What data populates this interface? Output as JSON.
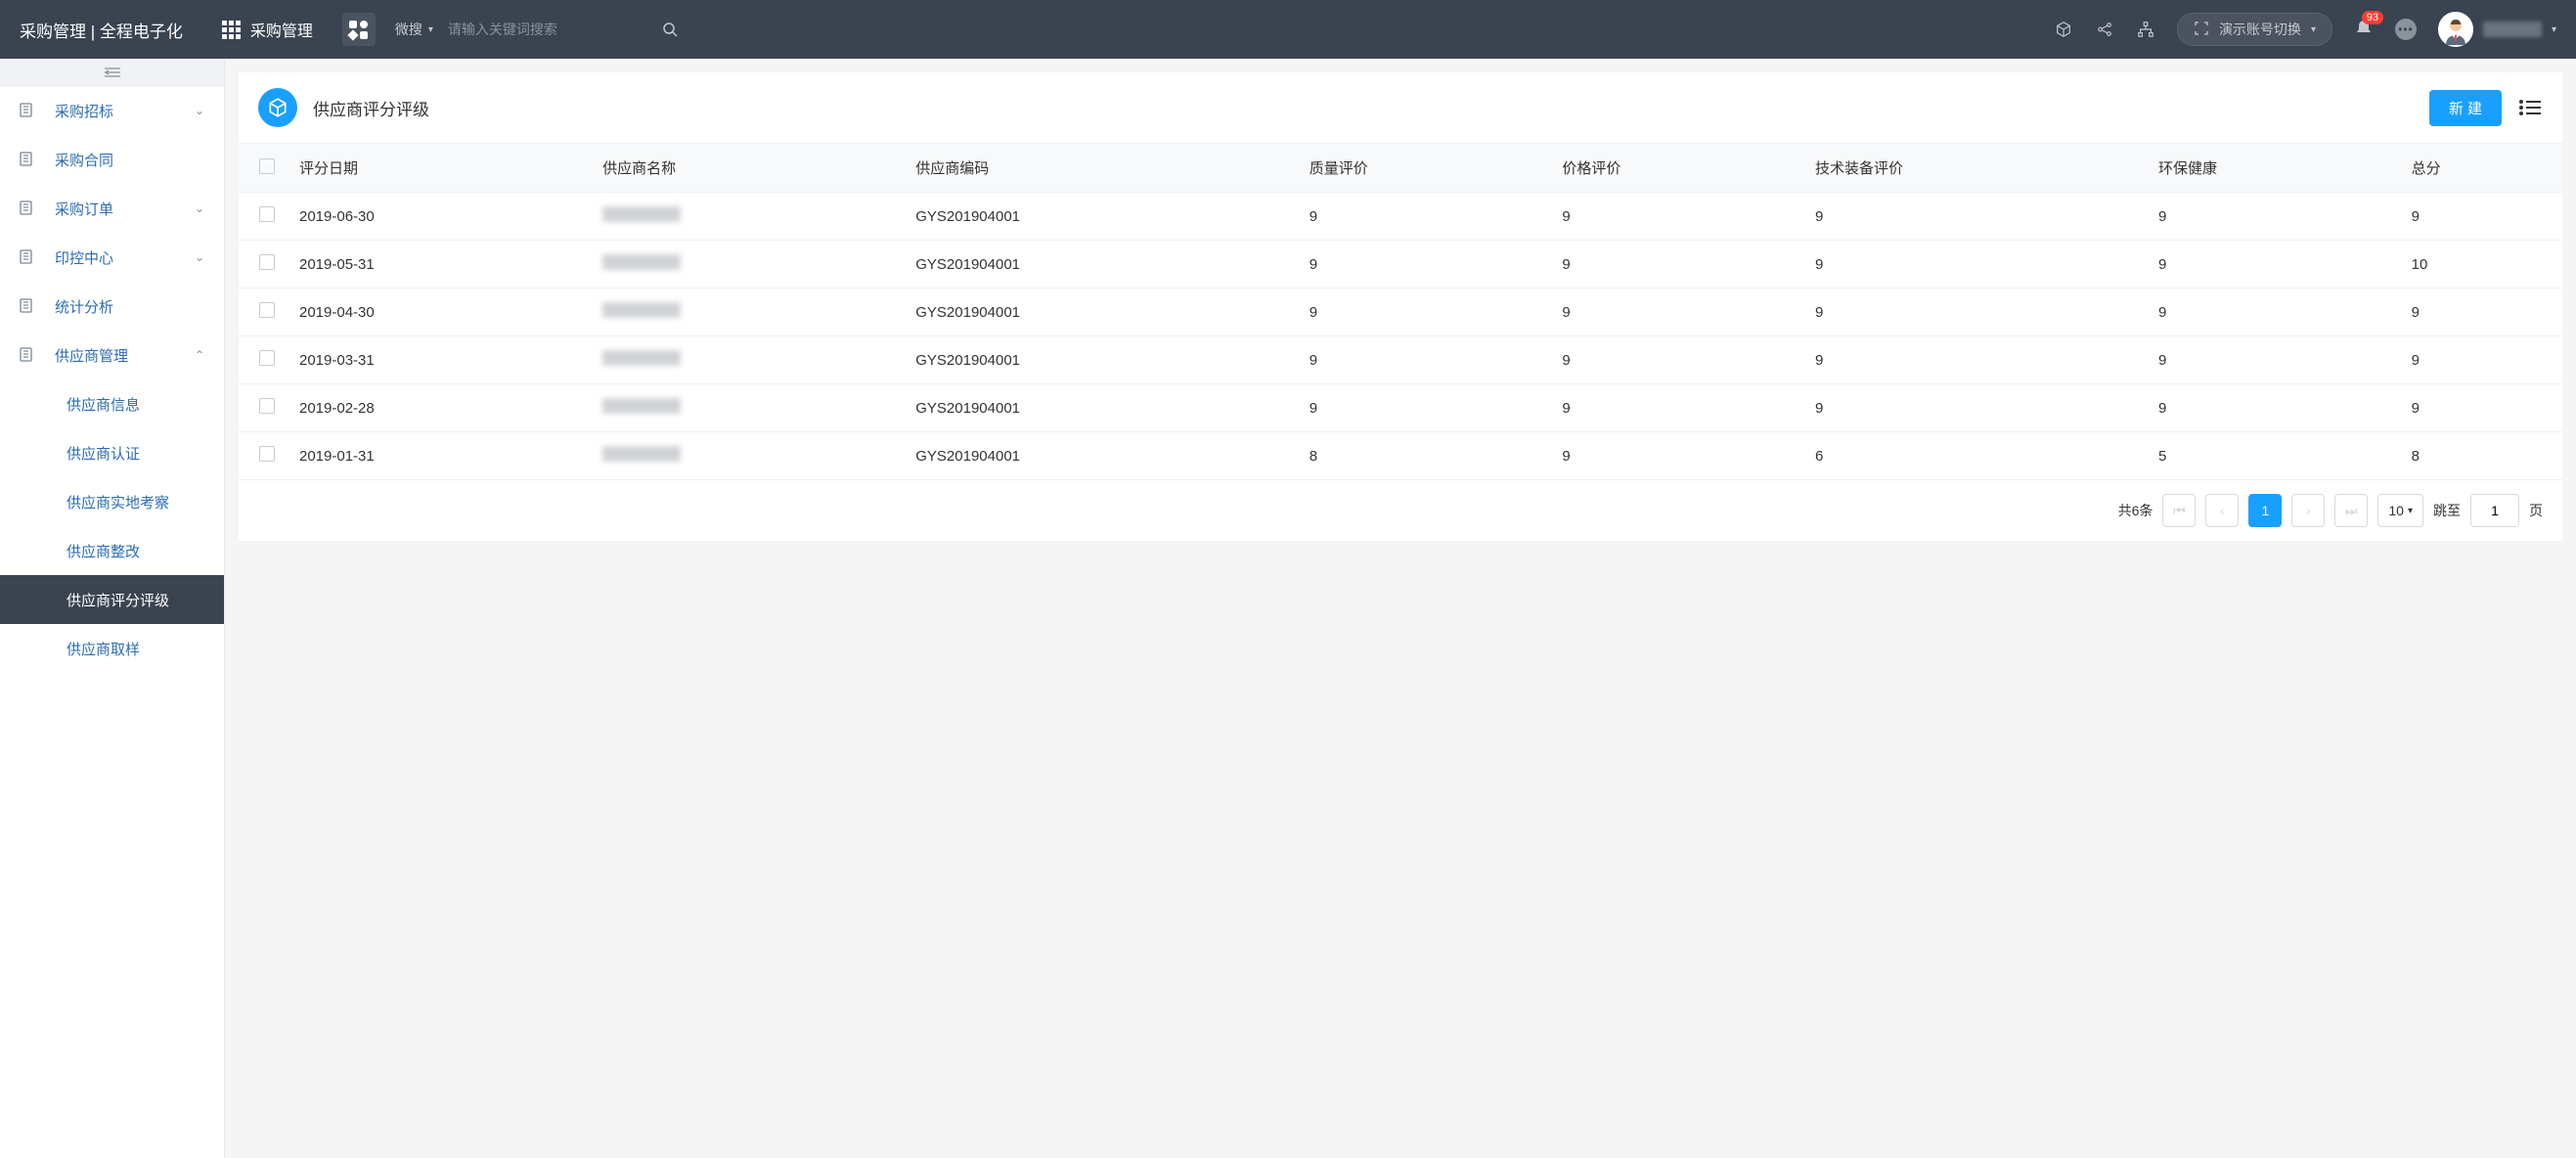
{
  "header": {
    "title": "采购管理 | 全程电子化",
    "apps_label": "采购管理",
    "search_type": "微搜",
    "search_placeholder": "请输入关键词搜索",
    "account_switch": "演示账号切换",
    "badge_count": "93"
  },
  "sidebar": {
    "items": [
      {
        "label": "采购招标",
        "expandable": true,
        "expanded": false
      },
      {
        "label": "采购合同",
        "expandable": false
      },
      {
        "label": "采购订单",
        "expandable": true,
        "expanded": false
      },
      {
        "label": "印控中心",
        "expandable": true,
        "expanded": false
      },
      {
        "label": "统计分析",
        "expandable": false
      },
      {
        "label": "供应商管理",
        "expandable": true,
        "expanded": true
      }
    ],
    "sub_items": [
      {
        "label": "供应商信息",
        "active": false
      },
      {
        "label": "供应商认证",
        "active": false
      },
      {
        "label": "供应商实地考察",
        "active": false
      },
      {
        "label": "供应商整改",
        "active": false
      },
      {
        "label": "供应商评分评级",
        "active": true
      },
      {
        "label": "供应商取样",
        "active": false
      }
    ]
  },
  "panel": {
    "title": "供应商评分评级",
    "new_button": "新 建"
  },
  "table": {
    "columns": [
      "评分日期",
      "供应商名称",
      "供应商编码",
      "质量评价",
      "价格评价",
      "技术装备评价",
      "环保健康",
      "总分"
    ],
    "rows": [
      {
        "date": "2019-06-30",
        "code": "GYS201904001",
        "quality": "9",
        "price": "9",
        "tech": "9",
        "env": "9",
        "total": "9"
      },
      {
        "date": "2019-05-31",
        "code": "GYS201904001",
        "quality": "9",
        "price": "9",
        "tech": "9",
        "env": "9",
        "total": "10"
      },
      {
        "date": "2019-04-30",
        "code": "GYS201904001",
        "quality": "9",
        "price": "9",
        "tech": "9",
        "env": "9",
        "total": "9"
      },
      {
        "date": "2019-03-31",
        "code": "GYS201904001",
        "quality": "9",
        "price": "9",
        "tech": "9",
        "env": "9",
        "total": "9"
      },
      {
        "date": "2019-02-28",
        "code": "GYS201904001",
        "quality": "9",
        "price": "9",
        "tech": "9",
        "env": "9",
        "total": "9"
      },
      {
        "date": "2019-01-31",
        "code": "GYS201904001",
        "quality": "8",
        "price": "9",
        "tech": "6",
        "env": "5",
        "total": "8"
      }
    ]
  },
  "pagination": {
    "total_text": "共6条",
    "current_page": "1",
    "page_size": "10",
    "jump_label": "跳至",
    "jump_value": "1",
    "jump_suffix": "页"
  }
}
